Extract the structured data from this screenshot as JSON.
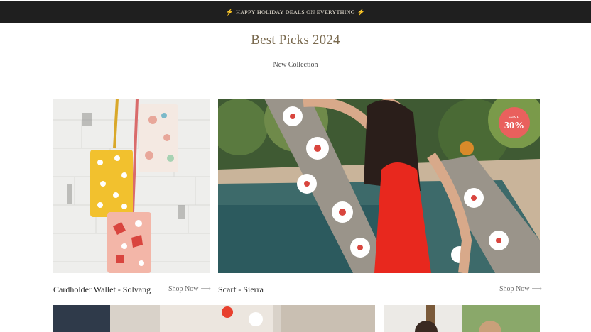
{
  "announcement": {
    "icon": "lightning-icon",
    "text": "HAPPY HOLIDAY DEALS ON EVERYTHING"
  },
  "heading": {
    "title": "Best Picks 2024",
    "subtitle": "New Collection"
  },
  "products": [
    {
      "name": "Cardholder Wallet - Solvang",
      "link_label": "Shop Now",
      "link_icon": "arrow-right-icon",
      "image": "wallets-on-white-brick-wall"
    },
    {
      "name": "Scarf - Sierra",
      "link_label": "Shop Now",
      "link_icon": "arrow-right-icon",
      "image": "woman-red-swimsuit-holding-floral-scarf-by-pool",
      "badge": {
        "line1": "save",
        "line2": "30%"
      }
    }
  ],
  "colors": {
    "announcement_bg": "#1f1f1f",
    "title": "#7a6a4f",
    "badge": "#e9605d"
  }
}
